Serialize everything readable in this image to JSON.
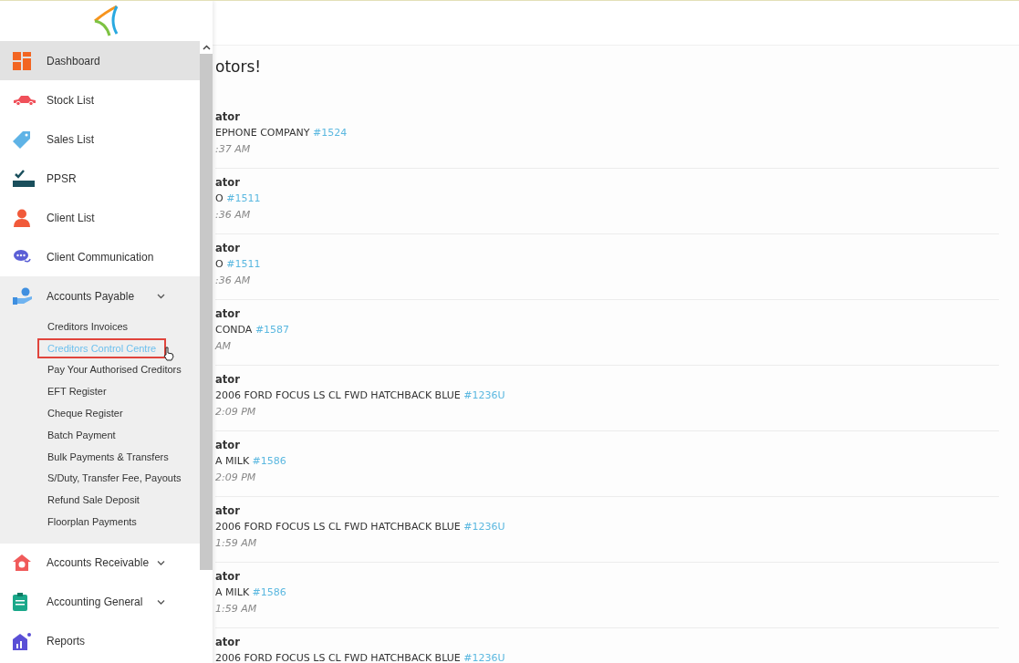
{
  "heading": "otors!",
  "feed": [
    {
      "author": "ator",
      "subject": "EPHONE COMPANY",
      "ref": "#1524",
      "time": ":37 AM"
    },
    {
      "author": "ator",
      "subject": "O",
      "ref": "#1511",
      "time": ":36 AM"
    },
    {
      "author": "ator",
      "subject": "O",
      "ref": "#1511",
      "time": ":36 AM"
    },
    {
      "author": "ator",
      "subject": "CONDA",
      "ref": "#1587",
      "time": "AM"
    },
    {
      "author": "ator",
      "subject": "2006 FORD FOCUS LS CL FWD HATCHBACK BLUE",
      "ref": "#1236U",
      "time": "2:09 PM"
    },
    {
      "author": "ator",
      "subject": "A MILK",
      "ref": "#1586",
      "time": "2:09 PM"
    },
    {
      "author": "ator",
      "subject": "2006 FORD FOCUS LS CL FWD HATCHBACK BLUE",
      "ref": "#1236U",
      "time": "1:59 AM"
    },
    {
      "author": "ator",
      "subject": "A MILK",
      "ref": "#1586",
      "time": "1:59 AM"
    },
    {
      "author": "ator",
      "subject": "2006 FORD FOCUS LS CL FWD HATCHBACK BLUE",
      "ref": "#1236U"
    }
  ],
  "sidebar": {
    "items": [
      {
        "label": "Dashboard",
        "selected": true
      },
      {
        "label": "Stock List",
        "selected": false
      },
      {
        "label": "Sales List",
        "selected": false
      },
      {
        "label": "PPSR",
        "selected": false
      },
      {
        "label": "Client List",
        "selected": false
      },
      {
        "label": "Client Communication",
        "selected": false
      },
      {
        "label": "Accounts Payable",
        "selected": false,
        "expanded": true,
        "children": [
          {
            "label": "Creditors Invoices",
            "selected": false
          },
          {
            "label": "Creditors Control Centre",
            "selected": true
          },
          {
            "label": "Pay Your Authorised Creditors",
            "selected": false
          },
          {
            "label": "EFT Register",
            "selected": false
          },
          {
            "label": "Cheque Register",
            "selected": false
          },
          {
            "label": "Batch Payment",
            "selected": false
          },
          {
            "label": "Bulk Payments & Transfers",
            "selected": false
          },
          {
            "label": "S/Duty, Transfer Fee, Payouts",
            "selected": false
          },
          {
            "label": "Refund Sale Deposit",
            "selected": false
          },
          {
            "label": "Floorplan Payments",
            "selected": false
          }
        ]
      },
      {
        "label": "Accounts Receivable",
        "selected": false,
        "expanded": false
      },
      {
        "label": "Accounting General",
        "selected": false,
        "expanded": false
      },
      {
        "label": "Reports",
        "selected": false
      }
    ]
  }
}
